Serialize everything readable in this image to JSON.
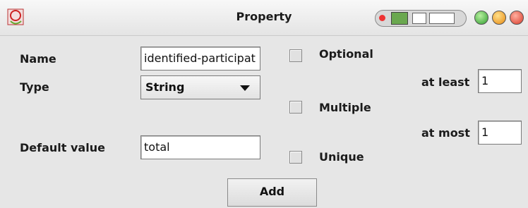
{
  "window": {
    "title": "Property",
    "tray_icon": "tray-control-icon",
    "buttons": {
      "green": "#2f9d2f",
      "orange": "#e88a12",
      "red": "#d93a2a"
    }
  },
  "form": {
    "name_label": "Name",
    "name_value": "identified-participat",
    "type_label": "Type",
    "type_value": "String",
    "default_label": "Default value",
    "default_value": "total",
    "optional_label": "Optional",
    "multiple_label": "Multiple",
    "unique_label": "Unique",
    "at_least_label": "at least",
    "at_least_value": "1",
    "at_most_label": "at most",
    "at_most_value": "1",
    "add_button": "Add"
  }
}
